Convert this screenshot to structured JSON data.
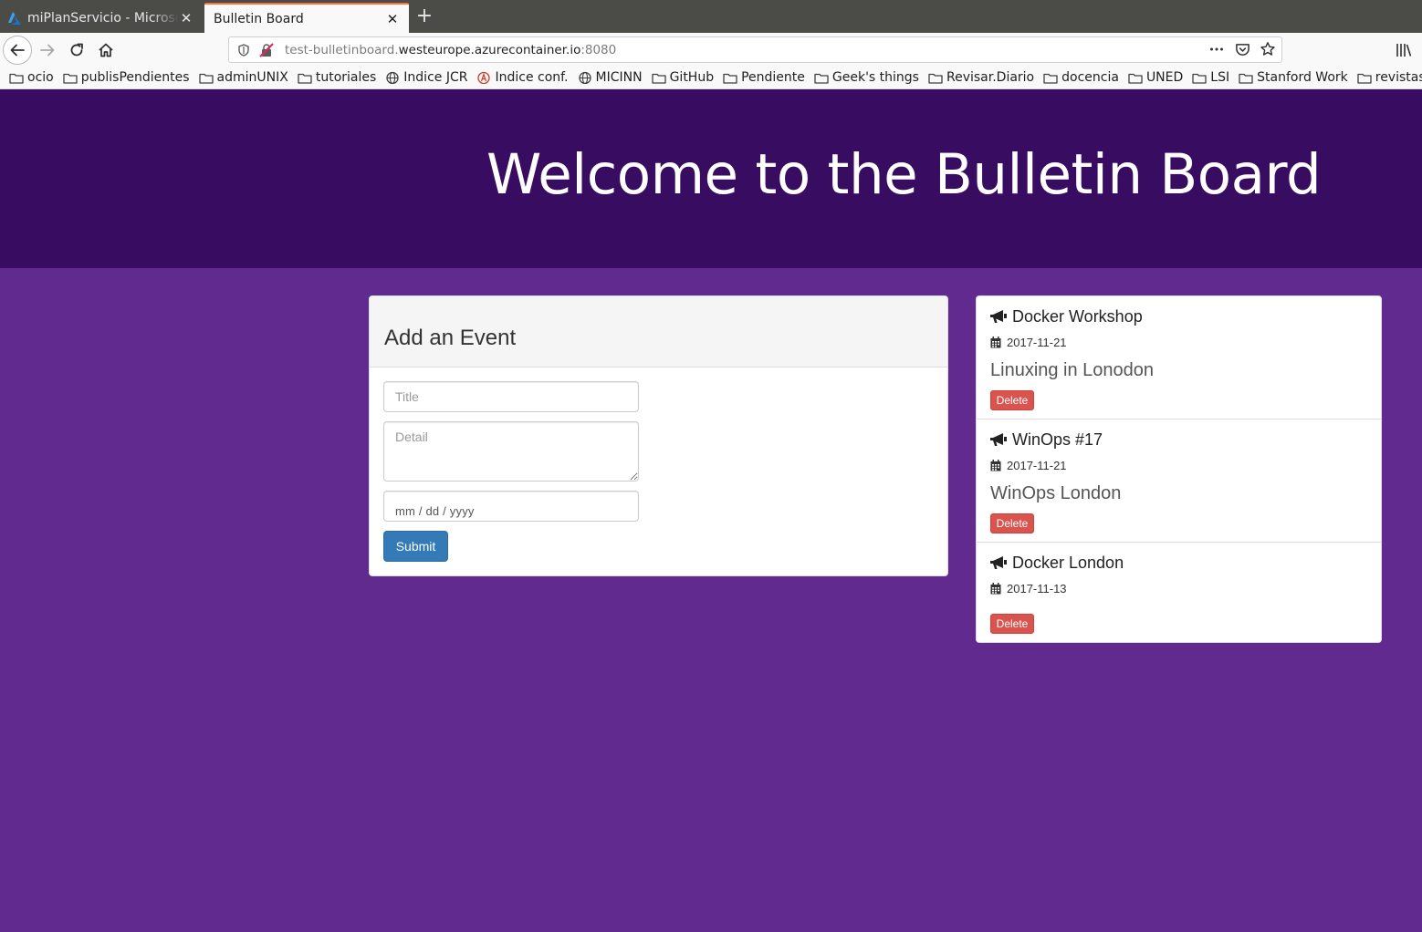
{
  "browser": {
    "tabs": [
      {
        "title": "miPlanServicio - Microsoft Azure",
        "active": false
      },
      {
        "title": "Bulletin Board",
        "active": true
      }
    ],
    "url": {
      "prefix": "test-bulletinboard.",
      "host": "westeurope.azurecontainer.io",
      "port": ":8080"
    },
    "bookmarks": [
      {
        "label": "ocio",
        "icon": "folder-icon"
      },
      {
        "label": "publisPendientes",
        "icon": "folder-icon"
      },
      {
        "label": "adminUNIX",
        "icon": "folder-icon"
      },
      {
        "label": "tutoriales",
        "icon": "folder-icon"
      },
      {
        "label": "Indice JCR",
        "icon": "globe-icon"
      },
      {
        "label": "Indice conf.",
        "icon": "site-icon"
      },
      {
        "label": "MICINN",
        "icon": "globe-icon"
      },
      {
        "label": "GitHub",
        "icon": "folder-icon"
      },
      {
        "label": "Pendiente",
        "icon": "folder-icon"
      },
      {
        "label": "Geek's things",
        "icon": "folder-icon"
      },
      {
        "label": "Revisar.Diario",
        "icon": "folder-icon"
      },
      {
        "label": "docencia",
        "icon": "folder-icon"
      },
      {
        "label": "UNED",
        "icon": "folder-icon"
      },
      {
        "label": "LSI",
        "icon": "folder-icon"
      },
      {
        "label": "Stanford Work",
        "icon": "folder-icon"
      },
      {
        "label": "revistas",
        "icon": "folder-icon"
      }
    ]
  },
  "page": {
    "heading": "Welcome to the Bulletin Board",
    "form": {
      "title": "Add an Event",
      "title_placeholder": "Title",
      "detail_placeholder": "Detail",
      "date_placeholder": "mm / dd / yyyy",
      "submit_label": "Submit"
    },
    "events": [
      {
        "title": "Docker Workshop",
        "date": "2017-11-21",
        "detail": "Linuxing in Lonodon",
        "delete_label": "Delete"
      },
      {
        "title": "WinOps #17",
        "date": "2017-11-21",
        "detail": "WinOps London",
        "delete_label": "Delete"
      },
      {
        "title": "Docker London",
        "date": "2017-11-13",
        "detail": "",
        "delete_label": "Delete"
      }
    ]
  },
  "colors": {
    "header_bg": "#380c61",
    "page_bg": "#612a8e",
    "submit": "#337ab7",
    "delete": "#d9534f",
    "tab_accent": "#ff7139"
  }
}
